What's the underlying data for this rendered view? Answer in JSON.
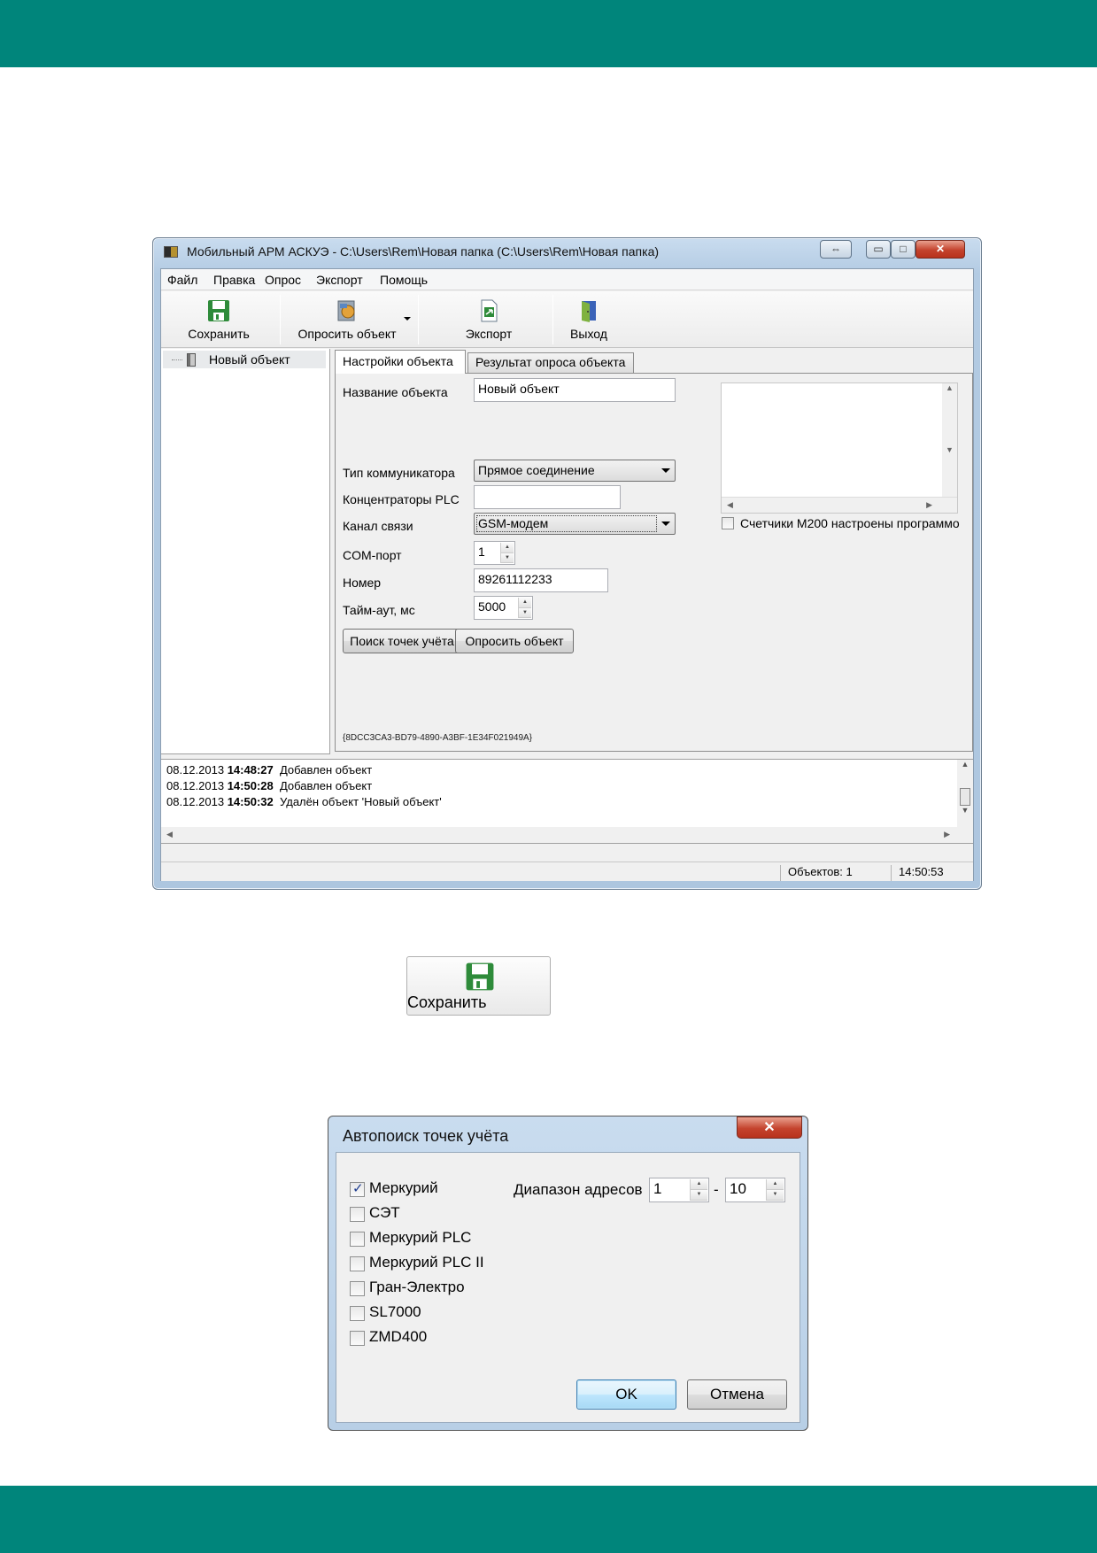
{
  "colors": {
    "band": "#00857b",
    "window_frame": "#b3cbe3",
    "close_button": "#c4432d",
    "save_icon": "#2e8b3a"
  },
  "window": {
    "title": "Мобильный АРМ АСКУЭ - C:\\Users\\Rem\\Новая папка (C:\\Users\\Rem\\Новая папка)",
    "controls": [
      "⇔",
      "▭",
      "□",
      "✕"
    ]
  },
  "menu": [
    "Файл",
    "Правка",
    "Опрос",
    "Экспорт",
    "Помощь"
  ],
  "toolbar": {
    "save": "Сохранить",
    "poll": "Опросить объект",
    "export": "Экспорт",
    "exit": "Выход"
  },
  "tree": {
    "item": "Новый объект"
  },
  "tabs": [
    "Настройки объекта",
    "Результат опроса объекта"
  ],
  "form": {
    "name_label": "Название объекта",
    "name_value": "Новый объект",
    "communicator_label": "Тип коммуникатора",
    "communicator_value": "Прямое соединение",
    "plc_label": "Концентраторы PLC",
    "plc_value": "",
    "channel_label": "Канал связи",
    "channel_value": "GSM-модем",
    "m200_checkbox": "Счетчики М200 настроены программо",
    "com_label": "COM-порт",
    "com_value": "1",
    "number_label": "Номер",
    "number_value": "89261112233",
    "timeout_label": "Тайм-аут, мс",
    "timeout_value": "5000",
    "search_button": "Поиск точек учёта",
    "poll_button": "Опросить объект",
    "guid": "{8DCC3CA3-BD79-4890-A3BF-1E34F021949A}"
  },
  "log": [
    {
      "date": "08.12.2013",
      "time": "14:48:27",
      "text": "Добавлен объект"
    },
    {
      "date": "08.12.2013",
      "time": "14:50:28",
      "text": "Добавлен объект"
    },
    {
      "date": "08.12.2013",
      "time": "14:50:32",
      "text": "Удалён объект 'Новый объект'"
    }
  ],
  "status": {
    "objects": "Объектов: 1",
    "time": "14:50:53"
  },
  "save_illustration": {
    "label": "Сохранить"
  },
  "dialog": {
    "title": "Автопоиск точек учёта",
    "close": "✕",
    "meters": [
      {
        "label": "Меркурий",
        "checked": true
      },
      {
        "label": "СЭТ",
        "checked": false
      },
      {
        "label": "Меркурий PLC",
        "checked": false
      },
      {
        "label": "Меркурий PLC II",
        "checked": false
      },
      {
        "label": "Гран-Электро",
        "checked": false
      },
      {
        "label": "SL7000",
        "checked": false
      },
      {
        "label": "ZMD400",
        "checked": false
      }
    ],
    "range_label": "Диапазон адресов",
    "range_from": "1",
    "range_sep": "-",
    "range_to": "10",
    "ok": "OK",
    "cancel": "Отмена"
  }
}
